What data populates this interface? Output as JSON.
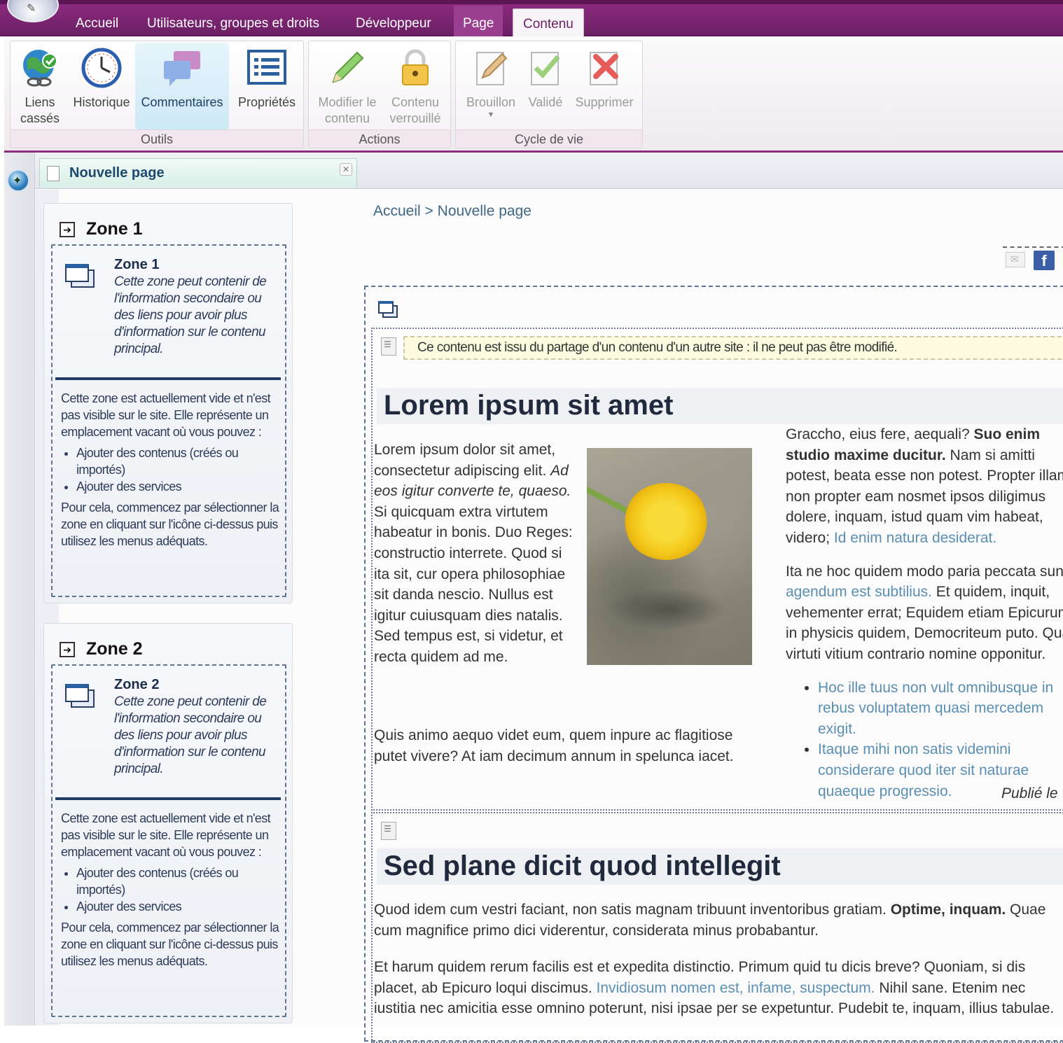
{
  "menu": {
    "tabs": [
      "Accueil",
      "Utilisateurs, groupes et droits",
      "Développeur",
      "Page",
      "Contenu"
    ]
  },
  "ribbon": {
    "groups": [
      {
        "label": "Outils",
        "buttons": [
          "Liens cassés",
          "Historique",
          "Commentaires",
          "Propriétés"
        ]
      },
      {
        "label": "Actions",
        "buttons": [
          "Modifier le contenu",
          "Contenu verrouillé"
        ]
      },
      {
        "label": "Cycle de vie",
        "buttons": [
          "Brouillon",
          "Validé",
          "Supprimer"
        ]
      }
    ]
  },
  "document_tab": {
    "title": "Nouvelle page"
  },
  "zones": [
    {
      "title": "Zone 1",
      "info_title": "Zone 1",
      "info_desc": "Cette zone peut contenir de l'information secondaire ou des liens pour avoir plus d'information sur le contenu principal.",
      "body_intro": "Cette zone est actuellement vide et n'est pas visible sur le site. Elle représente un emplacement vacant où vous pouvez :",
      "body_items": [
        "Ajouter des contenus (créés ou importés)",
        "Ajouter des services"
      ],
      "body_outro": "Pour cela, commencez par sélectionner la zone en cliquant sur l'icône ci-dessus puis utilisez les menus adéquats."
    },
    {
      "title": "Zone 2",
      "info_title": "Zone 2",
      "info_desc": "Cette zone peut contenir de l'information secondaire ou des liens pour avoir plus d'information sur le contenu principal.",
      "body_intro": "Cette zone est actuellement vide et n'est pas visible sur le site. Elle représente un emplacement vacant où vous pouvez :",
      "body_items": [
        "Ajouter des contenus (créés ou importés)",
        "Ajouter des services"
      ],
      "body_outro": "Pour cela, commencez par sélectionner la zone en cliquant sur l'icône ci-dessus puis utilisez les menus adéquats."
    }
  ],
  "breadcrumb": {
    "home": "Accueil",
    "sep": ">",
    "current": "Nouvelle page"
  },
  "content": {
    "shared_notice": "Ce contenu est issu du partage d'un contenu d'un autre site : il ne peut pas être modifié.",
    "article1": {
      "title": "Lorem ipsum sit amet",
      "left_p1_a": "Lorem ipsum dolor sit amet, consectetur adipiscing elit. ",
      "left_p1_em": "Ad eos igitur converte te, quaeso.",
      "left_p1_b": " Si quicquam extra virtutem habeatur in bonis. Duo Reges: constructio interrete. Quod si ita sit, cur opera philosophiae sit danda nescio. Nullus est igitur cuiusquam dies natalis. Sed tempus est, si videtur, et recta quidem ad me.",
      "left_p2": "Quis animo aequo videt eum, quem inpure ac flagitiose putet vivere? At iam decimum annum in spelunca iacet.",
      "right_p1_a": "Graccho, eius fere, aequali? ",
      "right_p1_strong": "Suo enim studio maxime ducitur.",
      "right_p1_b": " Nam si amitti potest, beata esse non potest. Propter illam, non propter eam nosmet ipsos diligimus dolere, inquam, istud quam vim habeat, videro; ",
      "right_p1_link": "Id enim natura desiderat.",
      "right_p2_a": "Ita ne hoc quidem modo paria peccata sunt. ",
      "right_p2_link": "agendum est subtilius.",
      "right_p2_b": " Et quidem, inquit, vehementer errat; Equidem etiam Epicurum, in physicis quidem, Democriteum puto. Quae virtuti vitium contrario nomine opponitur.",
      "list": [
        "Hoc ille tuus non vult omnibusque in rebus voluptatem quasi mercedem exigit.",
        "Itaque mihi non satis videmini considerare quod iter sit naturae quaeque progressio."
      ],
      "published": "Publié le"
    },
    "article2": {
      "title": "Sed plane dicit quod intellegit",
      "p1_a": "Quod idem cum vestri faciant, non satis magnam tribuunt inventoribus gratiam. ",
      "p1_strong": "Optime, inquam.",
      "p1_b": " Quae cum magnifice primo dici viderentur, considerata minus probabantur.",
      "p2_a": "Et harum quidem rerum facilis est et expedita distinctio. Primum quid tu dicis breve? Quoniam, si dis placet, ab Epicuro loqui discimus. ",
      "p2_link": "Invidiosum nomen est, infame, suspectum.",
      "p2_b": " Nihil sane. Etenim nec iustitia nec amicitia esse omnino poterunt, nisi ipsae per se expetuntur. Pudebit te, inquam, illius tabulae."
    }
  }
}
